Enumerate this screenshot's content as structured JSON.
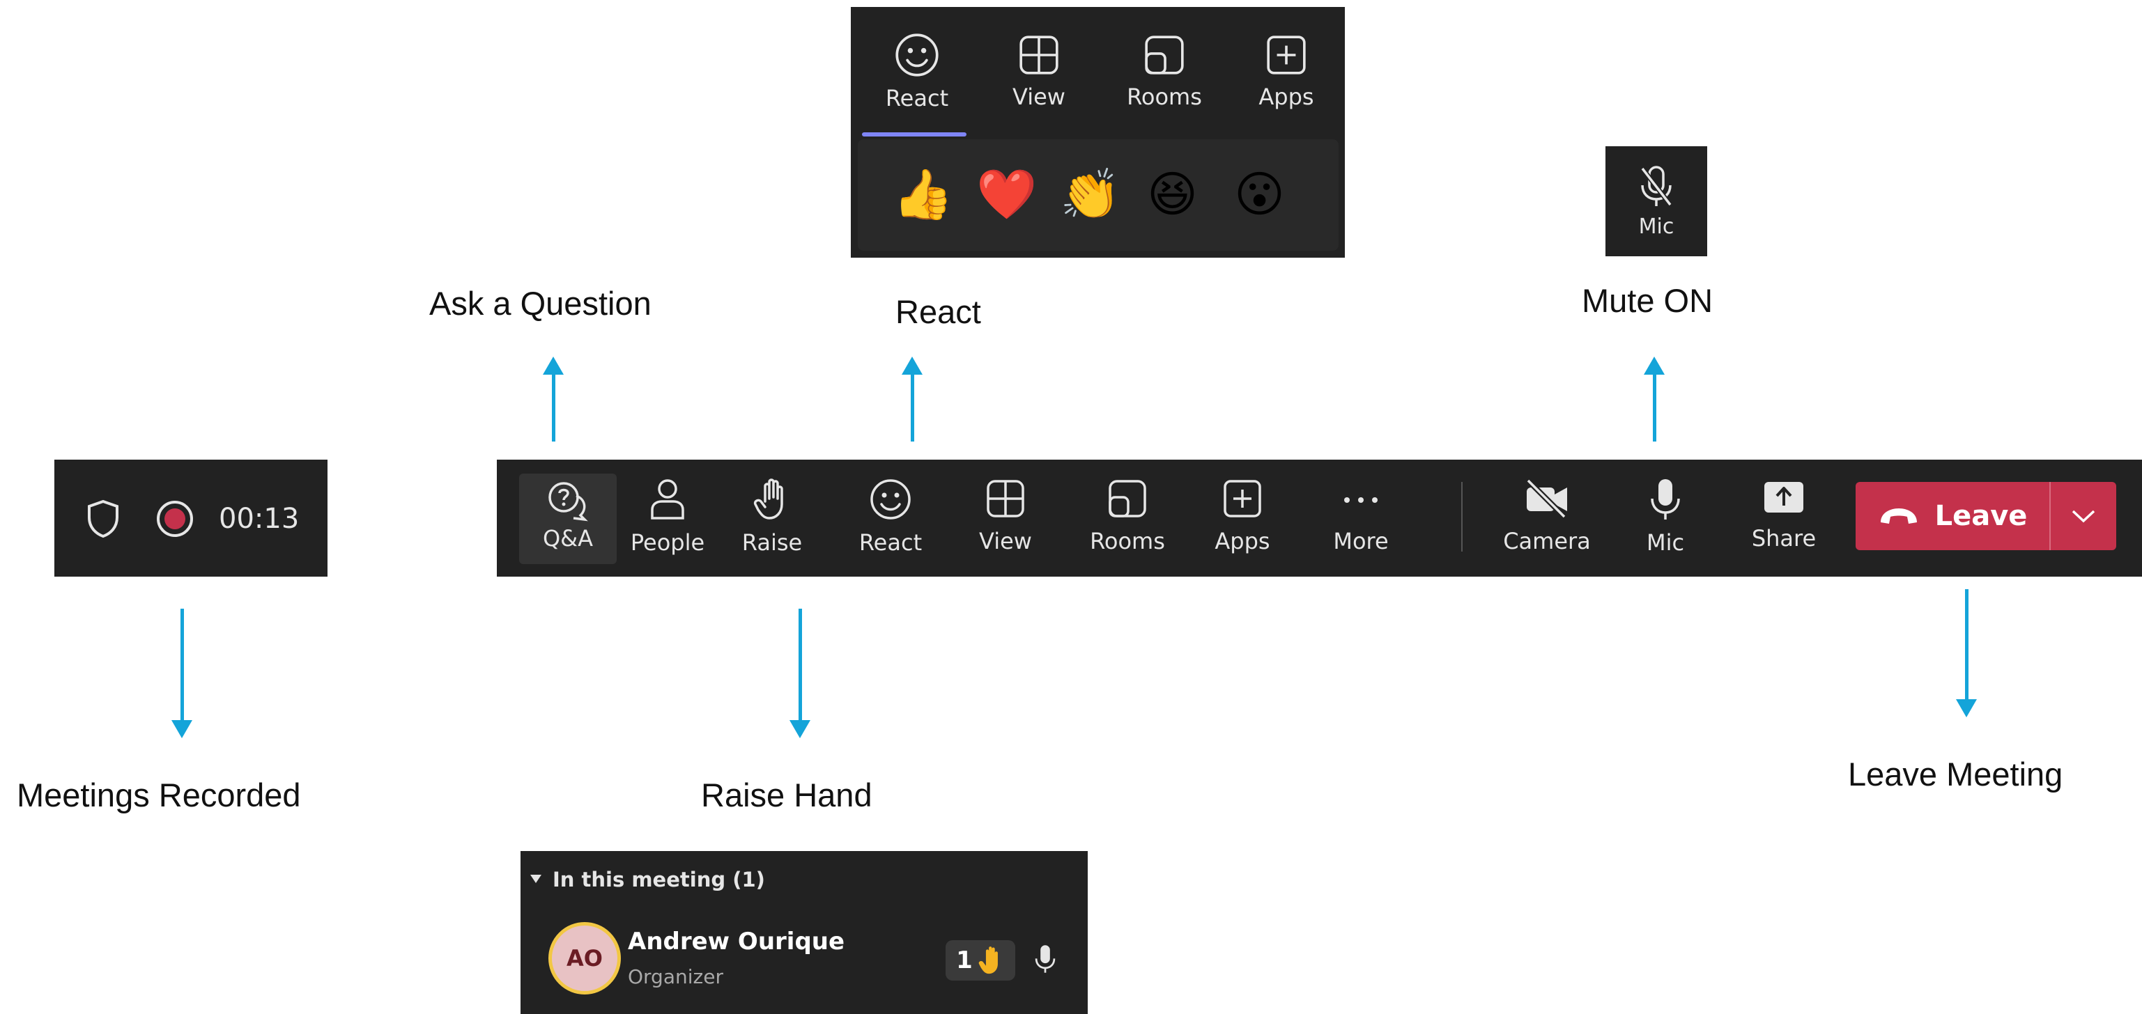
{
  "annotations": {
    "ask_question": "Ask a Question",
    "react": "React",
    "mute_on": "Mute ON",
    "meetings_recorded": "Meetings Recorded",
    "raise_hand": "Raise Hand",
    "leave_meeting": "Leave Meeting"
  },
  "recording_panel": {
    "time": "00:13",
    "icons": [
      "shield-icon",
      "record-icon"
    ],
    "record_color": "#c4314b"
  },
  "toolbar": {
    "items": [
      {
        "label": "Q&A",
        "icon": "qa-icon",
        "active": true
      },
      {
        "label": "People",
        "icon": "people-icon"
      },
      {
        "label": "Raise",
        "icon": "hand-icon"
      },
      {
        "label": "React",
        "icon": "smiley-icon"
      },
      {
        "label": "View",
        "icon": "grid-icon"
      },
      {
        "label": "Rooms",
        "icon": "rooms-icon"
      },
      {
        "label": "Apps",
        "icon": "plus-square-icon"
      },
      {
        "label": "More",
        "icon": "more-icon"
      },
      {
        "label": "Camera",
        "icon": "camera-off-icon"
      },
      {
        "label": "Mic",
        "icon": "mic-icon"
      },
      {
        "label": "Share",
        "icon": "share-icon"
      }
    ],
    "leave_label": "Leave",
    "leave_color": "#c4314b"
  },
  "react_popup": {
    "tabs": [
      {
        "label": "React",
        "icon": "smiley-icon",
        "selected": true
      },
      {
        "label": "View",
        "icon": "grid-icon"
      },
      {
        "label": "Rooms",
        "icon": "rooms-icon"
      },
      {
        "label": "Apps",
        "icon": "plus-square-icon"
      }
    ],
    "emojis": [
      "👍",
      "❤️",
      "👏",
      "😆",
      "😮"
    ],
    "underline_color": "#7f85f5"
  },
  "mic_popup": {
    "label": "Mic",
    "icon": "mic-off-icon"
  },
  "participants_panel": {
    "header": "In this meeting (1)",
    "participant": {
      "initials": "AO",
      "name": "Andrew Ourique",
      "role": "Organizer",
      "hand_count": "1"
    }
  },
  "colors": {
    "panel_bg": "#222222",
    "arrow": "#14a4d9"
  }
}
